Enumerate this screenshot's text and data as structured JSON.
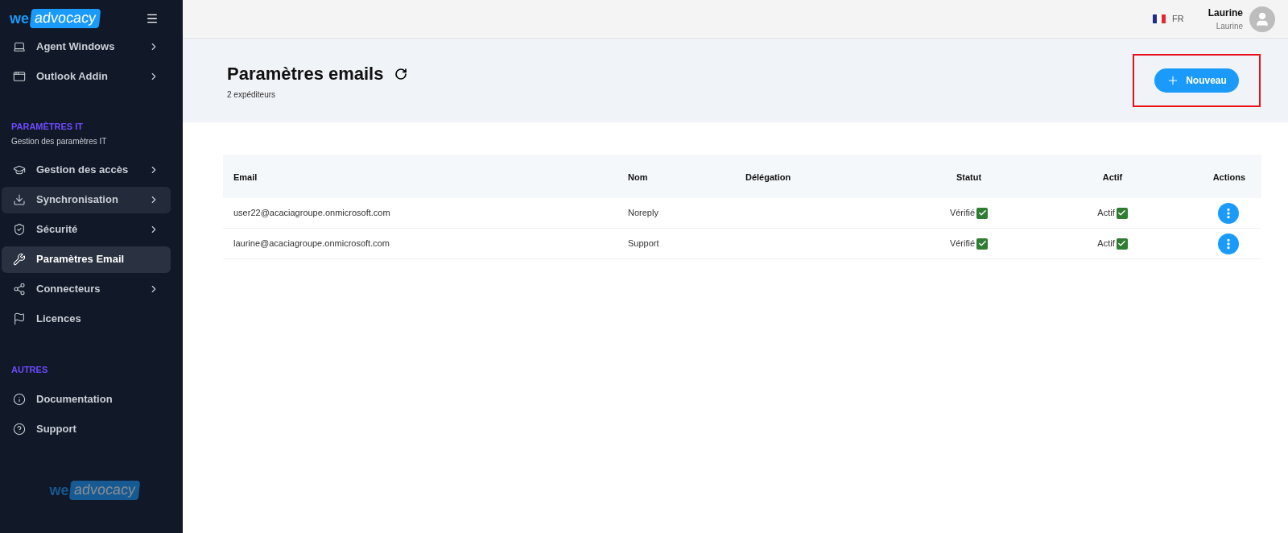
{
  "sidebar": {
    "logo": {
      "prefix": "we",
      "word": "advocacy"
    },
    "top_items": [
      {
        "label": "Agent Windows",
        "chevron": true,
        "selected": false,
        "hovered": false
      },
      {
        "label": "Outlook Addin",
        "chevron": true,
        "selected": false,
        "hovered": false
      }
    ],
    "sections": [
      {
        "title": "PARAMÈTRES IT",
        "subtitle": "Gestion des paramètres IT",
        "items": [
          {
            "label": "Gestion des accès",
            "chevron": true,
            "selected": false,
            "hovered": false
          },
          {
            "label": "Synchronisation",
            "chevron": true,
            "selected": false,
            "hovered": true
          },
          {
            "label": "Sécurité",
            "chevron": true,
            "selected": false,
            "hovered": false
          },
          {
            "label": "Paramètres Email",
            "chevron": false,
            "selected": true,
            "hovered": false
          },
          {
            "label": "Connecteurs",
            "chevron": true,
            "selected": false,
            "hovered": false
          },
          {
            "label": "Licences",
            "chevron": false,
            "selected": false,
            "hovered": false
          }
        ]
      },
      {
        "title": "AUTRES",
        "items": [
          {
            "label": "Documentation",
            "chevron": false,
            "selected": false,
            "hovered": false
          },
          {
            "label": "Support",
            "chevron": false,
            "selected": false,
            "hovered": false
          }
        ]
      }
    ],
    "footer_logo": {
      "prefix": "we",
      "word": "advocacy"
    }
  },
  "topbar": {
    "language": "FR",
    "user": {
      "name": "Laurine",
      "subtitle": "Laurine"
    }
  },
  "header": {
    "title": "Paramètres emails",
    "subtitle": "2 expéditeurs",
    "new_button": {
      "label": "Nouveau",
      "annotated": true
    }
  },
  "table": {
    "columns": [
      "Email",
      "Nom",
      "Délégation",
      "Statut",
      "Actif",
      "Actions"
    ],
    "rows": [
      {
        "email": "user22@acaciagroupe.onmicrosoft.com",
        "name": "Noreply",
        "status": "Vérifié",
        "status_checked": true,
        "active": "Actif",
        "active_checked": true
      },
      {
        "email": "laurine@acaciagroupe.onmicrosoft.com",
        "name": "Support",
        "status": "Vérifié",
        "status_checked": true,
        "active": "Actif",
        "active_checked": true
      }
    ]
  }
}
